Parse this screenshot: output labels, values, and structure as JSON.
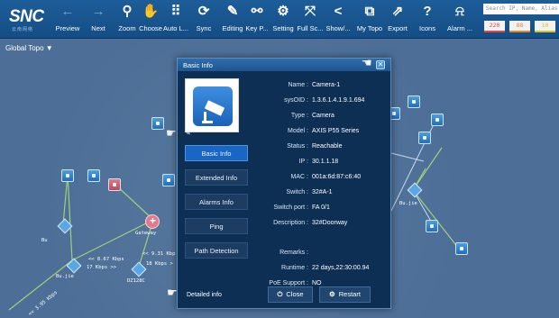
{
  "app": {
    "logo": "SNC",
    "logo_sub": "云南网络"
  },
  "toolbar": {
    "buttons": [
      {
        "label": "Preview",
        "icon": "arrow-left-icon",
        "glyph": "←"
      },
      {
        "label": "Next",
        "icon": "arrow-right-icon",
        "glyph": "→"
      },
      {
        "label": "Zoom",
        "icon": "magnifier-icon",
        "glyph": "⚲"
      },
      {
        "label": "Choose",
        "icon": "hand-icon",
        "glyph": "✋"
      },
      {
        "label": "Auto L...",
        "icon": "grid-icon",
        "glyph": "⠿"
      },
      {
        "label": "Sync",
        "icon": "sync-icon",
        "glyph": "⟳"
      },
      {
        "label": "Editing",
        "icon": "edit-icon",
        "glyph": "✎"
      },
      {
        "label": "Key P...",
        "icon": "key-path-icon",
        "glyph": "⚯"
      },
      {
        "label": "Setting",
        "icon": "gear-icon",
        "glyph": "⚙"
      },
      {
        "label": "Full Sc...",
        "icon": "fullscreen-icon",
        "glyph": "⤧"
      },
      {
        "label": "Show/...",
        "icon": "share-icon",
        "glyph": "<"
      },
      {
        "label": "My Topo",
        "icon": "topology-icon",
        "glyph": "⧉"
      },
      {
        "label": "Export",
        "icon": "export-icon",
        "glyph": "⇗"
      },
      {
        "label": "Icons",
        "icon": "help-icon",
        "glyph": "?"
      },
      {
        "label": "Alarm ...",
        "icon": "alarm-icon",
        "glyph": "⍾"
      }
    ],
    "search_placeholder": "Search IP, Name, Alias >",
    "alarm_counts": [
      {
        "value": "220",
        "color": "#e04848"
      },
      {
        "value": "88",
        "color": "#e08a2a"
      },
      {
        "value": "10",
        "color": "#d8c22a"
      }
    ]
  },
  "canvas": {
    "title": "Global Topo",
    "labels": [
      "<< 8.67 Kbps",
      "17 Kbps >>",
      "<< 9.31 Kbp",
      "18 Kbps >",
      "Gateway",
      "Bu",
      "DZ128C",
      "Bu.jie",
      "<< 3.95 Kbps",
      "Bu",
      "Bu.jie"
    ]
  },
  "dialog": {
    "title": "Basic Info",
    "close_glyph": "✕",
    "tabs": [
      {
        "label": "Basic Info",
        "active": true
      },
      {
        "label": "Extended Info",
        "active": false
      },
      {
        "label": "Alarms Info",
        "active": false
      },
      {
        "label": "Ping",
        "active": false
      },
      {
        "label": "Path Detection",
        "active": false
      }
    ],
    "detail_link": "Detailed info",
    "fields": [
      {
        "key": "Name :",
        "value": "Camera-1"
      },
      {
        "key": "sysOID :",
        "value": "1.3.6.1.4.1.9.1.694"
      },
      {
        "key": "Type :",
        "value": "Camera"
      },
      {
        "key": "Model :",
        "value": "AXIS P55 Series"
      },
      {
        "key": "Status :",
        "value": "Reachable"
      },
      {
        "key": "IP :",
        "value": "30.1.1.18"
      },
      {
        "key": "MAC :",
        "value": "001a:6d:87:c6:40"
      },
      {
        "key": "Switch :",
        "value": "32#A-1"
      },
      {
        "key": "Switch port :",
        "value": "FA 0/1"
      },
      {
        "key": "Description :",
        "value": "32#Doorway"
      }
    ],
    "fields2": [
      {
        "key": "Remarks :",
        "value": ""
      },
      {
        "key": "Runtime :",
        "value": "22 days,22:30:00.94"
      },
      {
        "key": "PoE Support :",
        "value": "NO"
      }
    ],
    "close_label": "Close",
    "restart_label": "Restart"
  }
}
